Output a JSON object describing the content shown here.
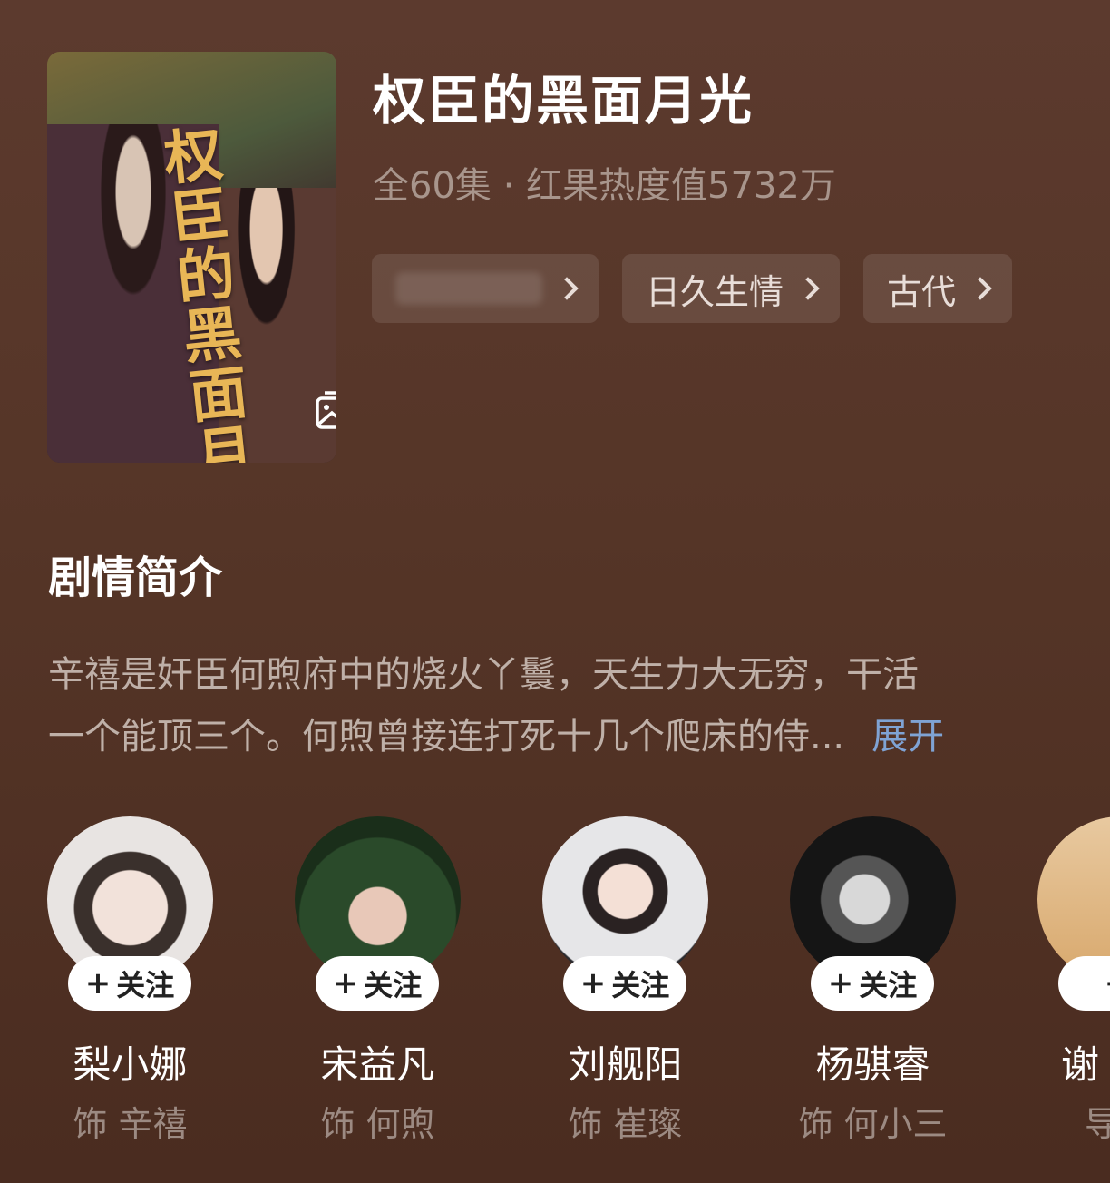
{
  "drama": {
    "title": "权臣的黑面月光",
    "meta": "全60集 · 红果热度值5732万",
    "poster_title_art": "权臣的黑面月光",
    "tags": [
      {
        "label": ""
      },
      {
        "label": "日久生情"
      },
      {
        "label": "古代"
      }
    ]
  },
  "synopsis": {
    "heading": "剧情简介",
    "line1": "辛禧是奸臣何煦府中的烧火丫鬟，天生力大无穷，干活",
    "line2": "一个能顶三个。何煦曾接连打死十几个爬床的侍...",
    "expand_label": "展开"
  },
  "cast": [
    {
      "name": "梨小娜",
      "role": "饰 辛禧",
      "follow_label": "关注"
    },
    {
      "name": "宋益凡",
      "role": "饰 何煦",
      "follow_label": "关注"
    },
    {
      "name": "刘舰阳",
      "role": "饰 崔璨",
      "follow_label": "关注"
    },
    {
      "name": "杨骐睿",
      "role": "饰 何小三",
      "follow_label": "关注"
    },
    {
      "name": "谢",
      "role": "导",
      "follow_label": ""
    }
  ],
  "icons": {
    "gallery": "gallery-icon",
    "chevron": "chevron-right-icon",
    "plus": "plus-icon"
  }
}
